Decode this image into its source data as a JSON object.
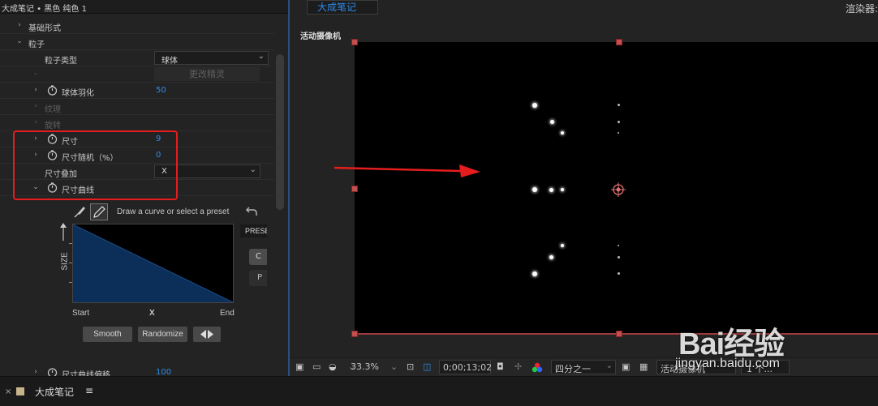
{
  "left_panel": {
    "title": "大成笔记 • 黑色 纯色 1",
    "groups": {
      "basic_form": "基础形式",
      "particle": "粒子"
    },
    "particle_type_label": "粒子类型",
    "particle_type_value": "球体",
    "change_sprite": "更改精灵",
    "sphere_feather_label": "球体羽化",
    "sphere_feather_value": "50",
    "texture_label": "纹理",
    "rotation_label": "旋转",
    "size_label": "尺寸",
    "size_value": "9",
    "size_random_label": "尺寸随机（%）",
    "size_random_value": "0",
    "size_blend_label": "尺寸叠加",
    "size_blend_value": "X",
    "size_curve_label": "尺寸曲线",
    "curve_hint": "Draw a curve or select a preset",
    "presets_tab": "PRESETS",
    "graph_y_label": "SIZE",
    "axis_start": "Start",
    "axis_x": "X",
    "axis_end": "End",
    "smooth_btn": "Smooth",
    "randomize_btn": "Randomize",
    "size_curve_offset_label": "尺寸曲线偏移",
    "size_curve_offset_value": "100"
  },
  "right_panel": {
    "tab_label": "大成笔记",
    "renderer_label": "渲染器:",
    "camera_label": "活动摄像机",
    "zoom": "33.3%",
    "timecode": "0;00;13;02",
    "resolution": "四分之一",
    "camera_select": "活动摄像机",
    "views": "1 个..."
  },
  "timeline": {
    "close": "×",
    "comp_name": "大成笔记",
    "menu": "≡"
  },
  "watermark": {
    "brand": "Bai经验",
    "url": "jingyan.baidu.com"
  },
  "colors": {
    "accent_blue": "#2d8ceb",
    "highlight_red": "#e61d1d",
    "curve_fill": "#0c2f5a"
  }
}
